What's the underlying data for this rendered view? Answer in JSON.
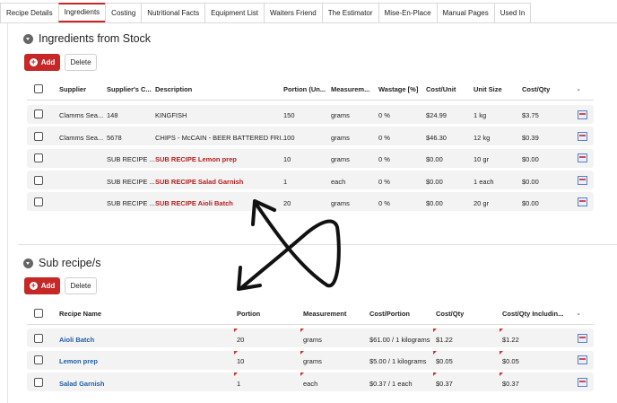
{
  "tabs": [
    "Recipe Details",
    "Ingredients",
    "Costing",
    "Nutritional Facts",
    "Equipment List",
    "Waiters Friend",
    "The Estimator",
    "Mise-En-Place",
    "Manual Pages",
    "Used In"
  ],
  "active_tab": "Ingredients",
  "stock": {
    "title": "Ingredients from Stock",
    "add_label": "Add",
    "delete_label": "Delete",
    "headers": [
      "Supplier",
      "Supplier's C...",
      "Description",
      "Portion (Un...",
      "Measurem...",
      "Wastage [%]",
      "Cost/Unit",
      "Unit Size",
      "Cost/Qty",
      "-"
    ],
    "rows": [
      {
        "supplier": "Clamms Sea...",
        "code": "148",
        "description": "KINGFISH",
        "portion": "150",
        "measurement": "grams",
        "wastage": "0 %",
        "cost_unit": "$24.99",
        "unit_size": "1 kg",
        "cost_qty": "$3.75",
        "sub": false
      },
      {
        "supplier": "Clamms Sea...",
        "code": "5678",
        "description": "CHIPS - McCAIN - BEER BATTERED FRI...",
        "portion": "100",
        "measurement": "grams",
        "wastage": "0 %",
        "cost_unit": "$46.30",
        "unit_size": "12 kg",
        "cost_qty": "$0.39",
        "sub": false
      },
      {
        "supplier": "",
        "code": "SUB RECIPE ...",
        "description": "SUB RECIPE Lemon prep",
        "portion": "10",
        "measurement": "grams",
        "wastage": "0 %",
        "cost_unit": "$0.00",
        "unit_size": "10 gr",
        "cost_qty": "$0.00",
        "sub": true
      },
      {
        "supplier": "",
        "code": "SUB RECIPE ...",
        "description": "SUB RECIPE Salad Garnish",
        "portion": "1",
        "measurement": "each",
        "wastage": "0 %",
        "cost_unit": "$0.00",
        "unit_size": "1 each",
        "cost_qty": "$0.00",
        "sub": true
      },
      {
        "supplier": "",
        "code": "SUB RECIPE ...",
        "description": "SUB RECIPE Aioli Batch",
        "portion": "20",
        "measurement": "grams",
        "wastage": "0 %",
        "cost_unit": "$0.00",
        "unit_size": "20 gr",
        "cost_qty": "$0.00",
        "sub": true
      }
    ]
  },
  "subrecipes": {
    "title": "Sub recipe/s",
    "add_label": "Add",
    "delete_label": "Delete",
    "headers": [
      "Recipe Name",
      "Portion",
      "Measurement",
      "Cost/Portion",
      "Cost/Qty",
      "Cost/Qty Includin...",
      "-"
    ],
    "rows": [
      {
        "name": "Aioli Batch",
        "portion": "20",
        "measurement": "grams",
        "cost_portion": "$61.00 / 1 kilograms",
        "cost_qty": "$1.22",
        "cost_qty_incl": "$1.22"
      },
      {
        "name": "Lemon prep",
        "portion": "10",
        "measurement": "grams",
        "cost_portion": "$5.00 / 1 kilograms",
        "cost_qty": "$0.05",
        "cost_qty_incl": "$0.05"
      },
      {
        "name": "Salad Garnish",
        "portion": "1",
        "measurement": "each",
        "cost_portion": "$0.37 / 1 each",
        "cost_qty": "$0.37",
        "cost_qty_incl": "$0.37"
      }
    ]
  },
  "colors": {
    "accent": "#c62828",
    "link": "#1f5fa8",
    "sub_recipe_text": "#b71c1c"
  },
  "icons": [
    "collapse-icon",
    "plus-icon",
    "edit-row-icon",
    "cross-arrows-annotation"
  ]
}
